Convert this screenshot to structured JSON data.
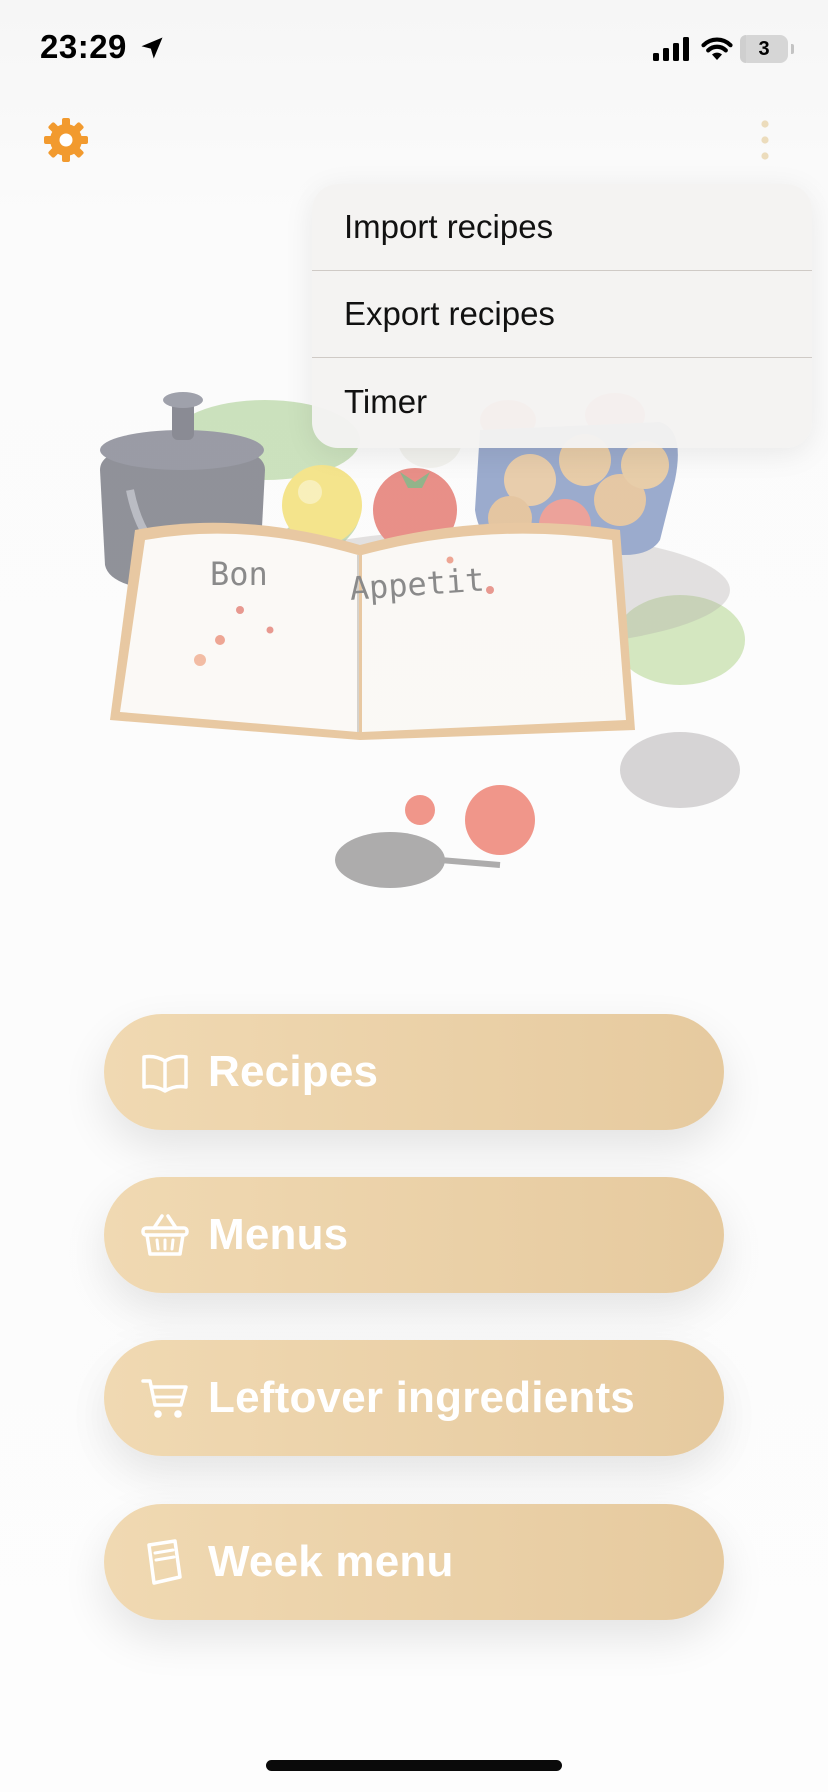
{
  "status_bar": {
    "time": "23:29",
    "battery_level": "3"
  },
  "nav": {
    "settings_icon": "gear-icon",
    "more_icon": "ellipsis-vertical-icon"
  },
  "dropdown": {
    "items": [
      {
        "label": "Import recipes"
      },
      {
        "label": "Export recipes"
      },
      {
        "label": "Timer"
      }
    ]
  },
  "hero": {
    "book_left_page_text": "Bon",
    "book_right_page_text": "Appetit"
  },
  "menu": {
    "buttons": [
      {
        "label": "Recipes",
        "icon": "book-icon"
      },
      {
        "label": "Menus",
        "icon": "basket-icon"
      },
      {
        "label": "Leftover ingredients",
        "icon": "cart-icon"
      },
      {
        "label": "Week menu",
        "icon": "note-icon"
      }
    ]
  },
  "colors": {
    "accent": "#f29a2e",
    "button_bg": "#ecd3aa",
    "button_text": "#ffffff"
  }
}
